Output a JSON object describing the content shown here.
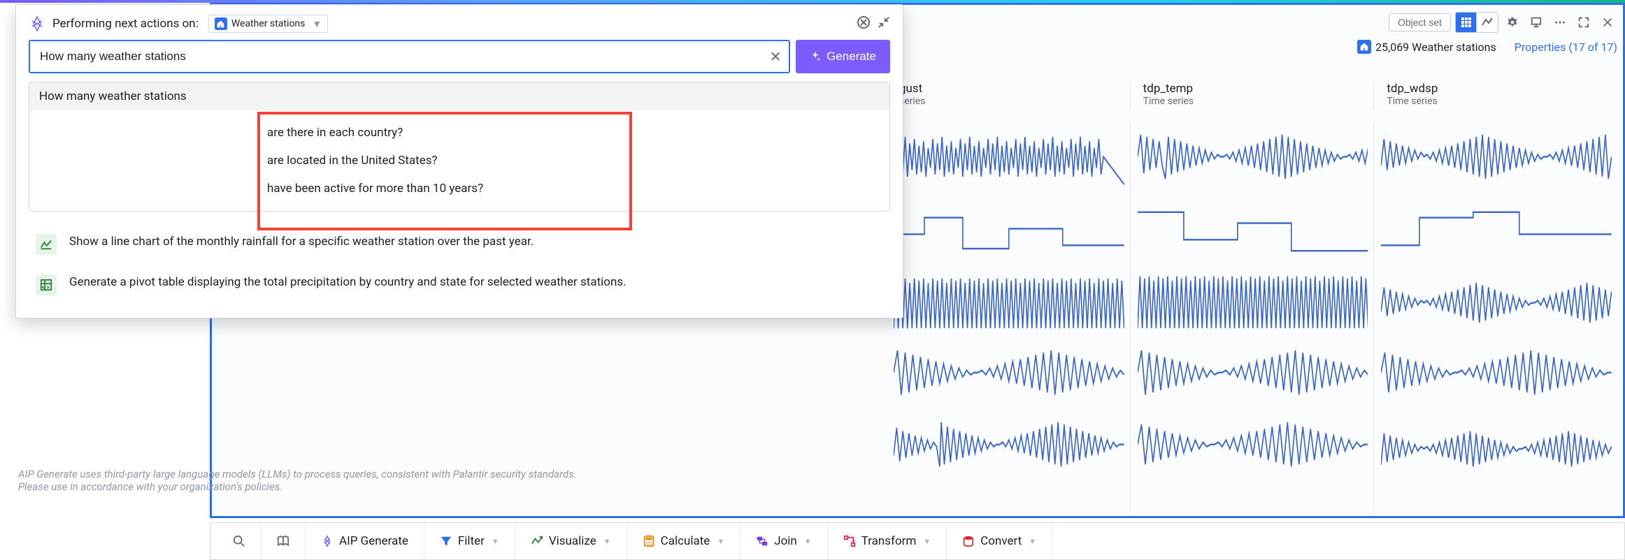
{
  "header": {
    "label": "Performing next actions on:",
    "chip_label": "Weather stations"
  },
  "search": {
    "value": "How many weather stations",
    "generate_label": "Generate"
  },
  "suggestions": {
    "header": "How many weather stations",
    "items": [
      "are there in each country?",
      "are located in the United States?",
      "have been active for more than 10 years?"
    ]
  },
  "actions": [
    {
      "id": "line",
      "text": "Show a line chart of the monthly rainfall for a specific weather station over the past year."
    },
    {
      "id": "pivot",
      "text": "Generate a pivot table displaying the total precipitation by country and state for selected weather stations."
    }
  ],
  "disclaimer_l1": "AIP Generate uses third-party large language models (LLMs) to process queries, consistent with Palantir security standards.",
  "disclaimer_l2": "Please use in accordance with your organization's policies.",
  "toolbar": {
    "object_set": "Object set"
  },
  "summary": {
    "count_label": "25,069 Weather stations",
    "properties_label": "Properties (17 of 17)"
  },
  "columns": [
    {
      "title": "gust",
      "sub": "series"
    },
    {
      "title": "tdp_temp",
      "sub": "Time series"
    },
    {
      "title": "tdp_wdsp",
      "sub": "Time series"
    }
  ],
  "bottom": {
    "aip": "AIP Generate",
    "filter": "Filter",
    "visualize": "Visualize",
    "calculate": "Calculate",
    "join": "Join",
    "transform": "Transform",
    "convert": "Convert"
  }
}
